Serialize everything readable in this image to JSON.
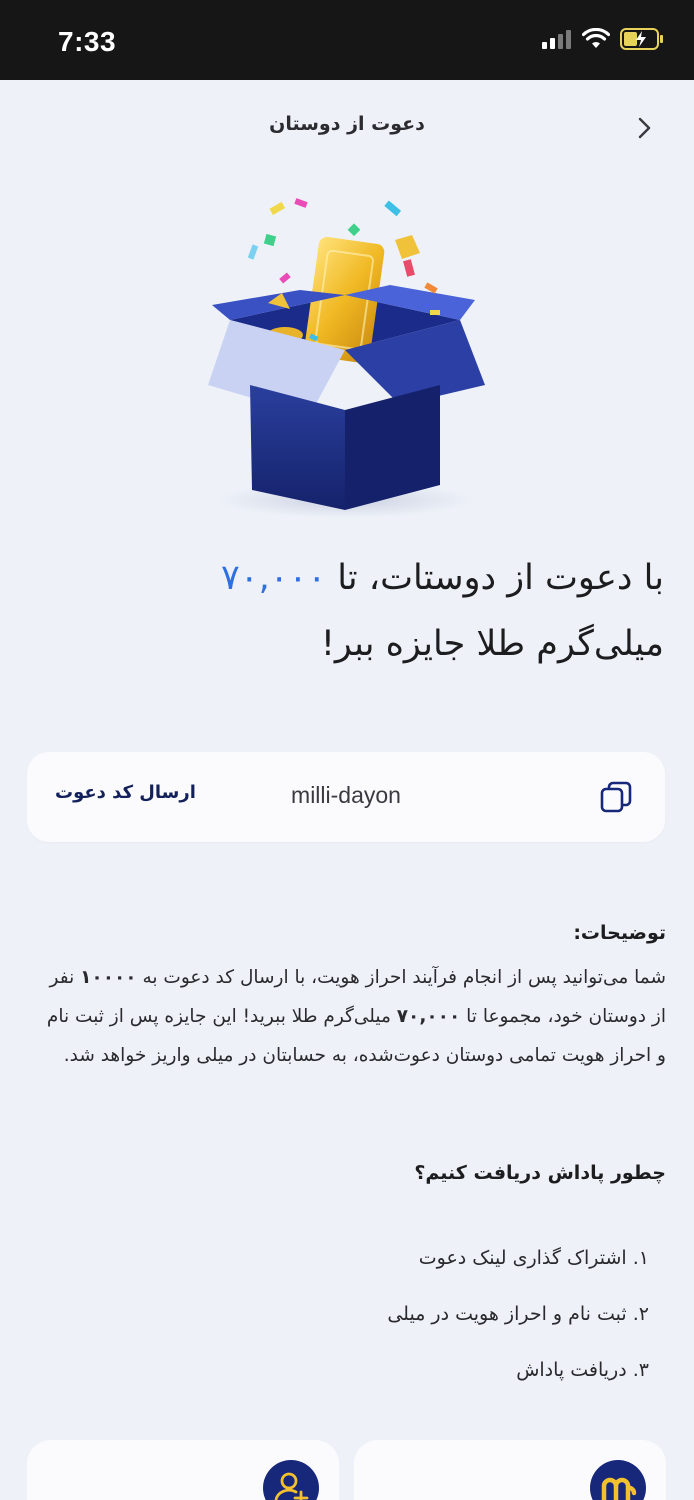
{
  "status_bar": {
    "time": "7:33"
  },
  "header": {
    "title": "دعوت از دوستان"
  },
  "headline": {
    "line1_prefix": "با دعوت از دوستات، تا ",
    "amount": "۷۰,۰۰۰",
    "line2": "میلی‌گرم طلا جایزه ببر!"
  },
  "invite": {
    "send_label": "ارسال کد دعوت",
    "code": "milli-dayon"
  },
  "description": {
    "title": "توضیحات:",
    "body_part1": "شما می‌توانید پس از انجام فرآیند احراز هویت، با ارسال کد دعوت به ",
    "count": "۱۰۰۰۰",
    "body_part2": " نفر از دوستان خود، مجموعا تا ",
    "amount": "۷۰,۰۰۰",
    "body_part3": " میلی‌گرم طلا ببرید! این جایزه پس از ثبت نام و احراز هویت تمامی دوستان دعوت‌شده، به حسابتان در میلی واریز خواهد شد."
  },
  "how": {
    "title": "چطور پاداش دریافت کنیم؟",
    "steps": [
      "۱. اشتراک گذاری لینک دعوت",
      "۲. ثبت نام و احراز هویت در میلی",
      "۳. دریافت پاداش"
    ]
  },
  "icons": {
    "back": "chevron-right-icon",
    "copy": "copy-icon",
    "add_user": "add-user-icon",
    "brand": "milli-logo-icon"
  },
  "colors": {
    "accent": "#2f6fe0",
    "brand_navy": "#17277a",
    "background": "#eef2f8"
  }
}
